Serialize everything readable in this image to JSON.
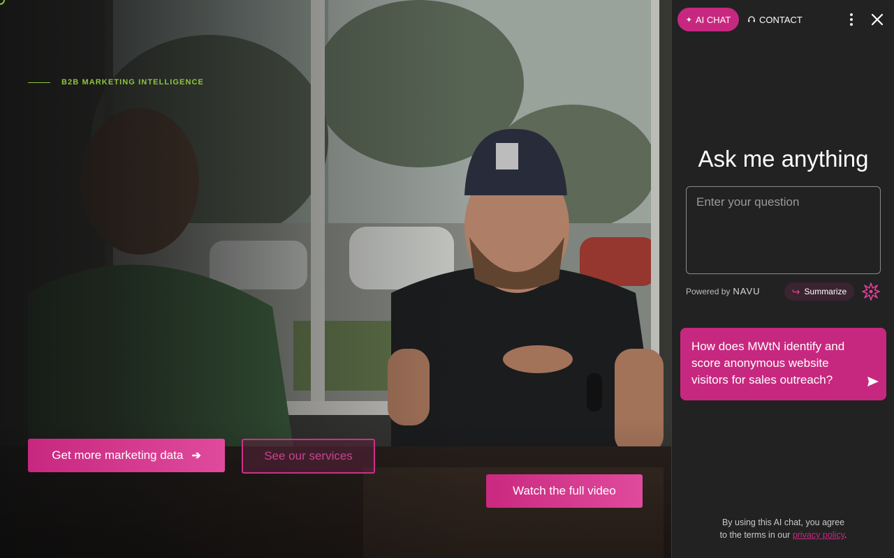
{
  "hero": {
    "eyebrow": "B2B MARKETING INTELLIGENCE",
    "primary_button": "Get more marketing data",
    "secondary_button": "See our services",
    "video_button": "Watch the full video"
  },
  "chat": {
    "tab_ai": "AI CHAT",
    "tab_contact": "CONTACT",
    "title": "Ask me anything",
    "input_placeholder": "Enter your question",
    "powered_by": "Powered by",
    "powered_brand": "NAVU",
    "summarize": "Summarize",
    "suggested_question": "How does MWtN identify and score anonymous website visitors for sales outreach?",
    "terms_prefix": "By using this AI chat, you agree",
    "terms_middle": "to the terms in our",
    "terms_link": "privacy policy",
    "terms_suffix": "."
  },
  "colors": {
    "accent_pink": "#c7287f",
    "accent_green": "#8dc63f",
    "panel_bg": "#222222"
  },
  "icons": [
    "sparkle-icon",
    "headset-icon",
    "kebab-menu-icon",
    "close-icon",
    "arrow-right-icon",
    "share-arrow-icon",
    "burst-icon",
    "send-icon"
  ]
}
